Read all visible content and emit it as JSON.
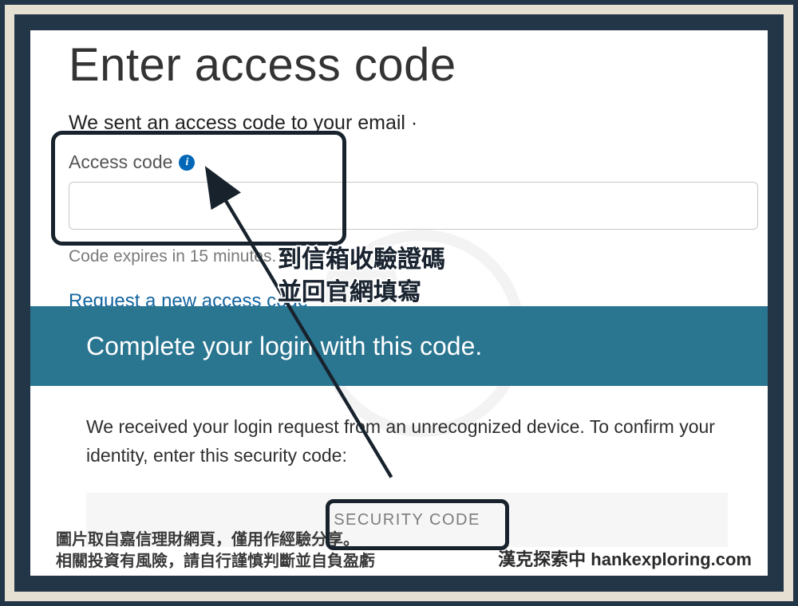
{
  "page": {
    "title": "Enter access code",
    "sent_text": "We sent an access code to your email ·",
    "label": "Access code",
    "expires": "Code expires in 15 minutes.",
    "request_link": "Request a new access code"
  },
  "email": {
    "banner": "Complete your login with this code.",
    "body": "We received your login request from an unrecognized device. To confirm your identity, enter this security code:",
    "security_code_label": "SECURITY CODE"
  },
  "annotation": {
    "line1": "到信箱收驗證碼",
    "line2": "並回官網填寫"
  },
  "footer": {
    "disclaimer_line1": "圖片取自嘉信理財網頁，僅用作經驗分享。",
    "disclaimer_line2": "相關投資有風險，請自行謹慎判斷並自負盈虧",
    "credit": "漢克探索中 hankexploring.com"
  },
  "icons": {
    "info": "i"
  }
}
